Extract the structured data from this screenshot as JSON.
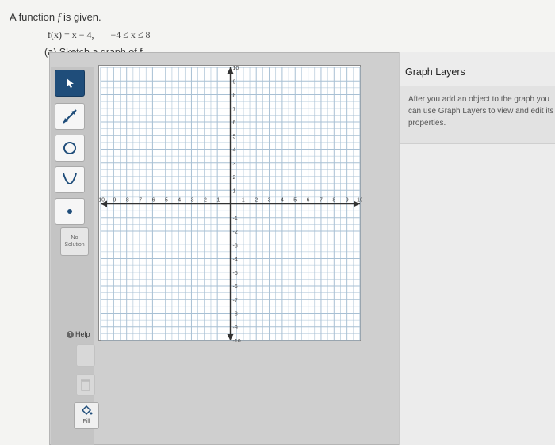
{
  "problem": {
    "prompt_prefix": "A function ",
    "prompt_var": "f",
    "prompt_suffix": " is given.",
    "function_def": "f(x) = x − 4,",
    "domain": "−4 ≤ x ≤ 8",
    "part_label": "(a) Sketch a graph of f."
  },
  "toolbar": {
    "tools": [
      {
        "name": "select",
        "icon": "arrow-pointer-icon"
      },
      {
        "name": "line",
        "icon": "line-segment-icon"
      },
      {
        "name": "circle",
        "icon": "circle-icon"
      },
      {
        "name": "parabola",
        "icon": "parabola-icon"
      },
      {
        "name": "point",
        "icon": "point-icon"
      }
    ],
    "no_solution_label": "No Solution",
    "help_label": "Help",
    "fill_label": "Fill",
    "active_color": "#1f4d7a"
  },
  "graph": {
    "xmin": -10,
    "xmax": 10,
    "ymin": -10,
    "ymax": 10,
    "grid_step": 0.5,
    "x_tick_labels": [
      "-10",
      "-9",
      "-8",
      "-7",
      "-6",
      "-5",
      "-4",
      "-3",
      "-2",
      "-1",
      "1",
      "2",
      "3",
      "4",
      "5",
      "6",
      "7",
      "8",
      "9",
      "10"
    ],
    "y_tick_labels": [
      "10",
      "9",
      "8",
      "7",
      "6",
      "5",
      "4",
      "3",
      "2",
      "1",
      "-1",
      "-2",
      "-3",
      "-4",
      "-5",
      "-6",
      "-7",
      "-8",
      "-9",
      "-10"
    ],
    "grid_color": "#a8c0d4",
    "axis_color": "#333333"
  },
  "layers": {
    "title": "Graph Layers",
    "info_line1": "After you add an object to the graph you",
    "info_line2": "can use Graph Layers to view and edit its",
    "info_line3": "properties."
  }
}
